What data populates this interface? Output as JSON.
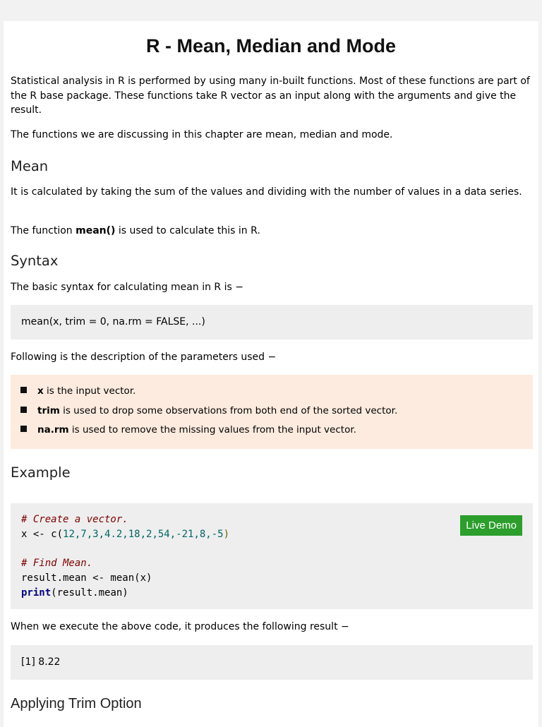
{
  "title": "R - Mean, Median and Mode",
  "intro": [
    "Statistical analysis in R is performed by using many in-built functions. Most of these functions are part of the R base package. These functions take R vector as an input along with the arguments and give the result.",
    "The functions we are discussing in this chapter are mean, median and mode."
  ],
  "mean": {
    "heading": "Mean",
    "p1": "It is calculated by taking the sum of the values and dividing with the number of values in a data series.",
    "p2_pre": "The function ",
    "p2_bold": "mean()",
    "p2_post": " is used to calculate this in R."
  },
  "syntax": {
    "heading": "Syntax",
    "p": "The basic syntax for calculating mean in R is −",
    "code": "mean(x, trim = 0, na.rm = FALSE, ...)",
    "desc": "Following is the description of the parameters used −",
    "params": [
      {
        "name": "x",
        "text": " is the input vector."
      },
      {
        "name": "trim",
        "text": " is used to drop some observations from both end of the sorted vector."
      },
      {
        "name": "na.rm",
        "text": " is used to remove the missing values from the input vector."
      }
    ]
  },
  "example": {
    "heading": "Example",
    "comment1": "# Create a vector.",
    "line2_pre": "x <- c(",
    "line2_nums": "12,7,3,4.2,18,2,54,-21,8,-5",
    "line2_post": ")",
    "comment2": "# Find Mean.",
    "line5": "result.mean <- mean(x)",
    "line6_kw": "print",
    "line6_rest": "(result.mean)",
    "live_demo": "Live Demo",
    "result_text": "When we execute the above code, it produces the following result −",
    "output": "[1] 8.22"
  },
  "next_heading": "Applying Trim Option"
}
